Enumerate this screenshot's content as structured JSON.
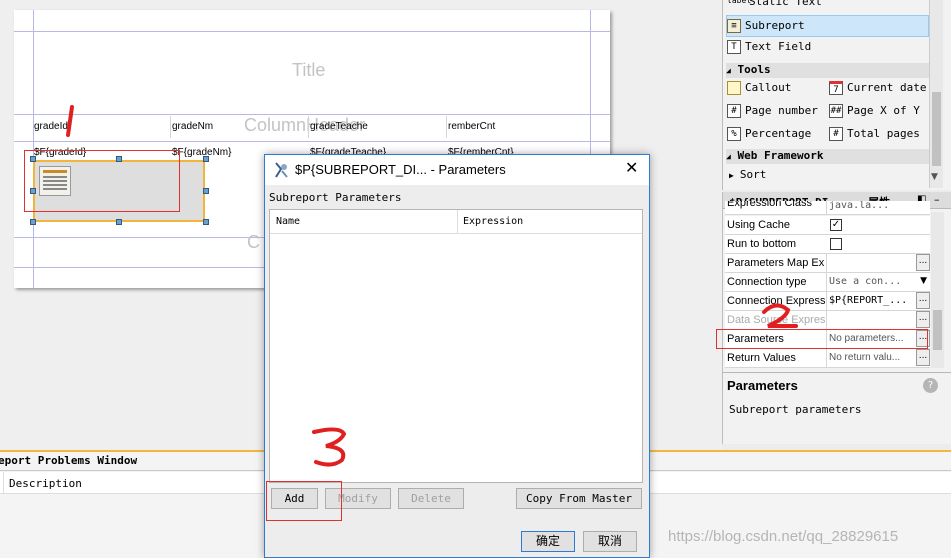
{
  "report": {
    "title_band": "Title",
    "column_header_band": "ColumnHeader",
    "c_band": "C",
    "header_fields": [
      "gradeId",
      "gradeNm",
      "gradeTeache",
      "remberCnt"
    ],
    "detail_fields": [
      "$F{gradeId}",
      "$F{gradeNm}",
      "$F{gradeTeache}",
      "$F{remberCnt}"
    ]
  },
  "palette": {
    "items": [
      {
        "label": "Static Text",
        "icon": "label"
      },
      {
        "label": "Subreport",
        "icon": "subreport-icon",
        "selected": true
      },
      {
        "label": "Text Field",
        "icon": "T"
      }
    ],
    "tools_header": "Tools",
    "tools": [
      {
        "label": "Callout",
        "icon": "callout-icon"
      },
      {
        "label": "Current date",
        "icon": "7"
      },
      {
        "label": "Page number",
        "icon": "#"
      },
      {
        "label": "Page X of Y",
        "icon": "##"
      },
      {
        "label": "Percentage",
        "icon": "%"
      },
      {
        "label": "Total pages",
        "icon": "#"
      }
    ],
    "web_header": "Web Framework",
    "sort": "Sort"
  },
  "properties": {
    "title": "$P{SUBREPORT_DI... - 属性",
    "rows": [
      {
        "name": "Expression Class",
        "value": "java.la..."
      },
      {
        "name": "Using Cache",
        "checkbox": true,
        "checked": true
      },
      {
        "name": "Run to bottom",
        "checkbox": true,
        "checked": false
      },
      {
        "name": "Parameters Map Expr",
        "value": ""
      },
      {
        "name": "Connection type",
        "value": "Use a con..."
      },
      {
        "name": "Connection Express",
        "value": "$P{REPORT_..."
      },
      {
        "name": "Data Source Expres",
        "value": ""
      },
      {
        "name": "Parameters",
        "value": "No parameters..."
      },
      {
        "name": "Return Values",
        "value": "No return valu..."
      }
    ],
    "help_title": "Parameters",
    "help_text": "Subreport parameters"
  },
  "problems": {
    "title": "eport Problems Window",
    "column": "Description"
  },
  "dialog": {
    "title": "$P{SUBREPORT_DI... - Parameters",
    "section": "Subreport Parameters",
    "columns": [
      "Name",
      "Expression"
    ],
    "buttons": {
      "add": "Add",
      "modify": "Modify",
      "delete": "Delete",
      "copy": "Copy From Master",
      "ok": "确定",
      "cancel": "取消"
    }
  },
  "annotations": [
    "1",
    "2",
    "3"
  ],
  "watermark": "https://blog.csdn.net/qq_28829615"
}
